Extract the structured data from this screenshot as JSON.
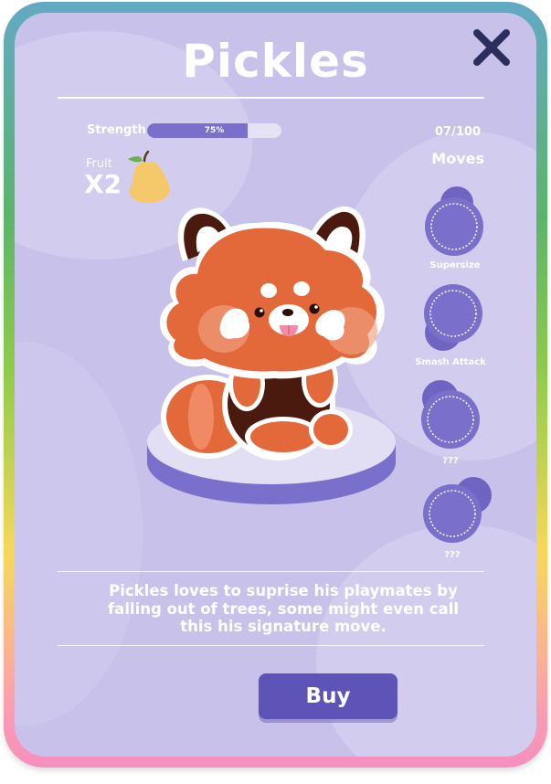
{
  "pet": {
    "name": "Pickles",
    "description": "Pickles loves to suprise his playmates by falling out of trees, some might even call this his signature move."
  },
  "stats": {
    "strength_label": "Strength",
    "strength_percent": 75,
    "strength_text": "75%",
    "fruit_label": "Fruit",
    "fruit_multiplier": "X2",
    "fruit_icon": "pear-icon"
  },
  "collection": {
    "count": "07/100"
  },
  "moves": {
    "heading": "Moves",
    "items": [
      {
        "label": "Supersize",
        "icon": "move-slot-icon"
      },
      {
        "label": "Smash Attack",
        "icon": "move-slot-icon"
      },
      {
        "label": "???",
        "icon": "locked-move-slot-icon"
      },
      {
        "label": "???",
        "icon": "locked-move-slot-icon"
      }
    ]
  },
  "actions": {
    "buy_label": "Buy",
    "close_icon": "close-icon"
  },
  "colors": {
    "card_background": "#c8c1ea",
    "accent": "#7a6fca",
    "button": "#5e53b6",
    "pet_orange": "#e3683a",
    "pet_brown": "#4a1a0e"
  }
}
